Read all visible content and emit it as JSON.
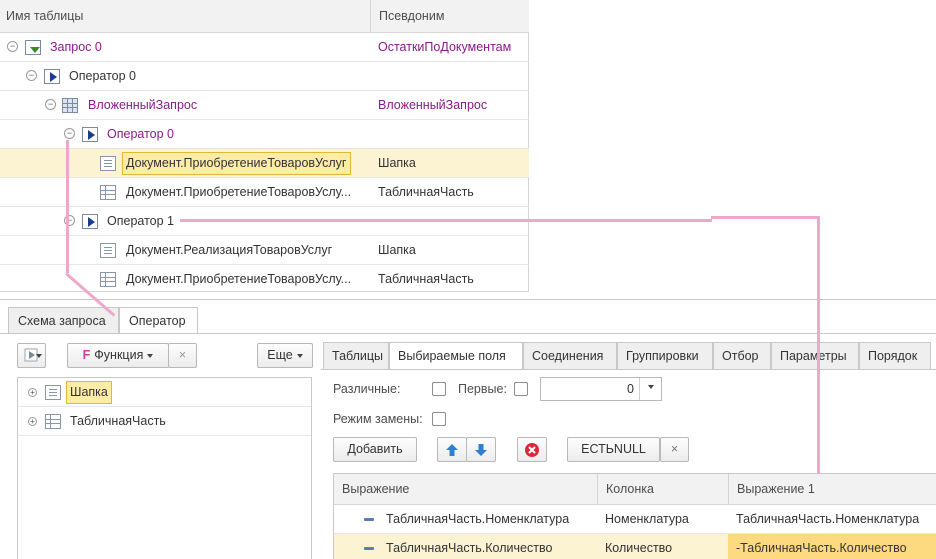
{
  "tree": {
    "col_name": "Имя таблицы",
    "col_alias": "Псевдоним",
    "rows": [
      {
        "name": "Запрос 0",
        "alias": "ОстаткиПоДокументам"
      },
      {
        "name": "Оператор 0",
        "alias": ""
      },
      {
        "name": "ВложенныйЗапрос",
        "alias": "ВложенныйЗапрос"
      },
      {
        "name": "Оператор 0",
        "alias": ""
      },
      {
        "name": "Документ.ПриобретениеТоваровУслуг",
        "alias": "Шапка"
      },
      {
        "name": "Документ.ПриобретениеТоваровУслу...",
        "alias": "ТабличнаяЧасть"
      },
      {
        "name": "Оператор 1",
        "alias": ""
      },
      {
        "name": "Документ.РеализацияТоваровУслуг",
        "alias": "Шапка"
      },
      {
        "name": "Документ.ПриобретениеТоваровУслу...",
        "alias": "ТабличнаяЧасть"
      }
    ]
  },
  "main_tabs": [
    "Схема запроса",
    "Оператор"
  ],
  "left_toolbar": {
    "function_icon": "F",
    "function_label": "Функция",
    "clear_symbol": "×",
    "more_label": "Еще"
  },
  "left_list": [
    "Шапка",
    "ТабличнаяЧасть"
  ],
  "operator_tabs": [
    "Таблицы",
    "Выбираемые поля",
    "Соединения",
    "Группировки",
    "Отбор",
    "Параметры",
    "Порядок"
  ],
  "options": {
    "distinct_label": "Различные:",
    "first_label": "Первые:",
    "first_value": "0",
    "replace_label": "Режим замены:"
  },
  "fields_toolbar": {
    "add_label": "Добавить",
    "isnull_label": "ЕСТЬNULL",
    "clear_symbol": "×"
  },
  "grid": {
    "headers": [
      "Выражение",
      "Колонка",
      "Выражение 1"
    ],
    "rows": [
      [
        "ТабличнаяЧасть.Номенклатура",
        "Номенклатура",
        "ТабличнаяЧасть.Номенклатура"
      ],
      [
        "ТабличнаяЧасть.Количество",
        "Количество",
        "-ТабличнаяЧасть.Количество"
      ]
    ]
  }
}
